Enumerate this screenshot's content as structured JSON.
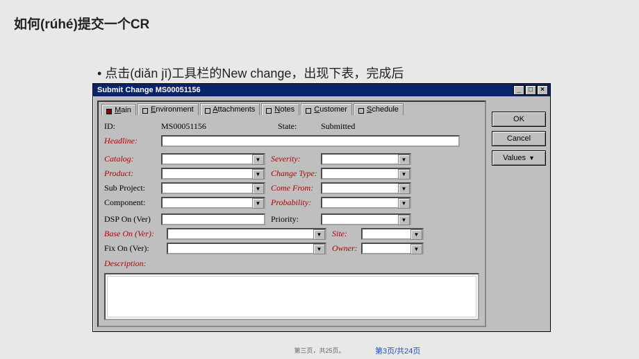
{
  "slide": {
    "title": "如何(rúhé)提交一个CR",
    "bullet": "• 点击(diǎn jī)工具栏的New change，出现下表，完成后"
  },
  "dialog": {
    "title": "Submit Change MS00051156",
    "tabs": {
      "main": "Main",
      "env": "Environment",
      "att": "Attachments",
      "notes": "Notes",
      "cust": "Customer",
      "sched": "Schedule"
    },
    "labels": {
      "id": "ID:",
      "state": "State:",
      "headline": "Headline:",
      "catalog": "Catalog:",
      "severity": "Severity:",
      "product": "Product:",
      "change_type": "Change Type:",
      "sub_project": "Sub Project:",
      "come_from": "Come From:",
      "component": "Component:",
      "probability": "Probability:",
      "dsp_on": "DSP On (Ver)",
      "priority": "Priority:",
      "base_on": "Base On (Ver):",
      "site": "Site:",
      "fix_on": "Fix On (Ver):",
      "owner": "Owner:",
      "description": "Description:"
    },
    "values": {
      "id": "MS00051156",
      "state": "Submitted",
      "headline": "",
      "catalog": "",
      "severity": "",
      "product": "",
      "change_type": "",
      "sub_project": "",
      "come_from": "",
      "component": "",
      "probability": "",
      "dsp_on": "",
      "priority": "",
      "base_on": "",
      "site": "",
      "fix_on": "",
      "owner": "",
      "description": ""
    },
    "buttons": {
      "ok": "OK",
      "cancel": "Cancel",
      "values": "Values"
    }
  },
  "footer": {
    "small": "第三页，共25页。",
    "page": "第3页/共24页"
  }
}
